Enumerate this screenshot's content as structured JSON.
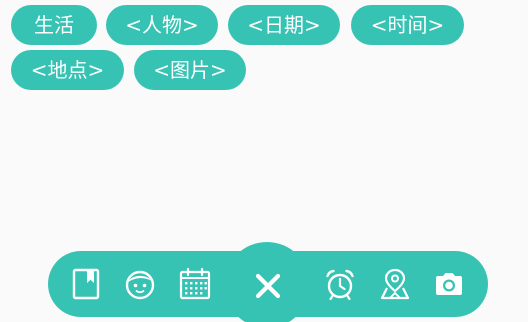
{
  "tags": {
    "items": [
      {
        "label": "生活"
      },
      {
        "label": "<人物>"
      },
      {
        "label": "<日期>"
      },
      {
        "label": "<时间>"
      },
      {
        "label": "<地点>"
      },
      {
        "label": "<图片>"
      }
    ]
  },
  "toolbar": {
    "icons": [
      "bookmark-icon",
      "face-icon",
      "calendar-icon",
      "close-icon",
      "alarm-clock-icon",
      "map-pin-icon",
      "camera-icon"
    ]
  },
  "colors": {
    "accent": "#37c3b3",
    "background": "#fafafa",
    "foreground": "#ffffff"
  }
}
